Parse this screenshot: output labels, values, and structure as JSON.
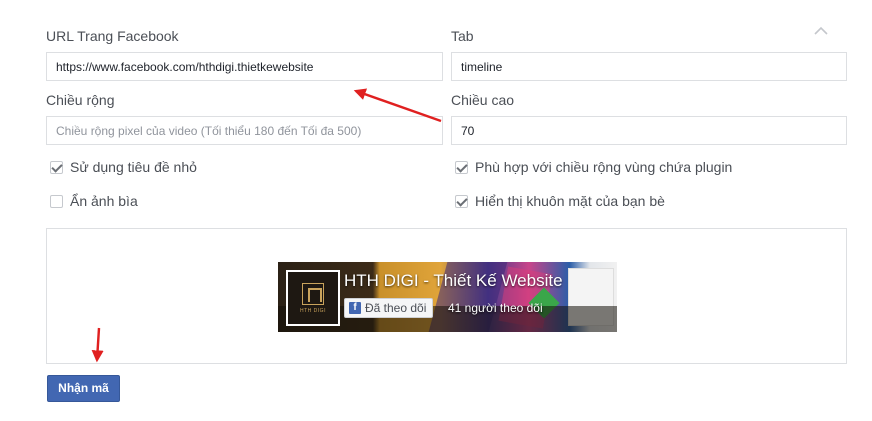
{
  "form": {
    "url_label": "URL Trang Facebook",
    "url_value": "https://www.facebook.com/hthdigi.thietkewebsite",
    "tab_label": "Tab",
    "tab_value": "timeline",
    "width_label": "Chiều rộng",
    "width_placeholder": "Chiều rộng pixel của video (Tối thiểu 180 đến Tối đa 500)",
    "height_label": "Chiều cao",
    "height_value": "70",
    "checkboxes": [
      {
        "label": "Sử dụng tiêu đề nhỏ",
        "checked": true
      },
      {
        "label": "Ẩn ảnh bìa",
        "checked": false
      },
      {
        "label": "Phù hợp với chiều rộng vùng chứa plugin",
        "checked": true
      },
      {
        "label": "Hiển thị khuôn mặt của bạn bè",
        "checked": true
      }
    ],
    "collapse_icon": "chevron-up-icon"
  },
  "preview": {
    "page_name": "HTH DIGI - Thiết Kế Website",
    "follow_label": "Đã theo dõi",
    "followers": "41 người theo dõi",
    "logo_text": "HTH DIGI"
  },
  "submit_label": "Nhận mã",
  "colors": {
    "primary": "#4267b2",
    "annotation_arrow": "#e02020",
    "border": "#dddfe2"
  }
}
